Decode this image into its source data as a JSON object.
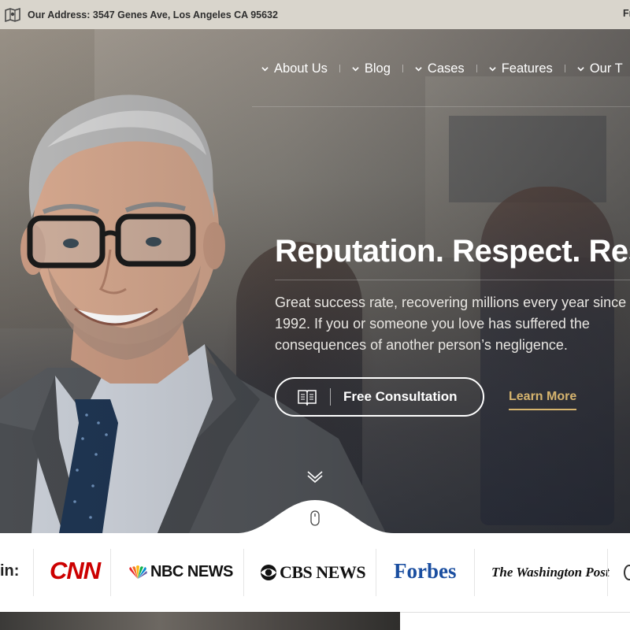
{
  "topbar": {
    "address": "Our Address: 3547 Genes Ave, Los Angeles CA 95632",
    "right_text": "Fr",
    "icon": "map-icon"
  },
  "nav": {
    "items": [
      {
        "label": "About Us"
      },
      {
        "label": "Blog"
      },
      {
        "label": "Cases"
      },
      {
        "label": "Features"
      },
      {
        "label": "Our T"
      }
    ]
  },
  "hero": {
    "headline": "Reputation. Respect. Result",
    "description": "Great success rate, recovering millions every year since 1992. If you or someone you love has suffered the consequences of another person’s negligence.",
    "consult_label": "Free Consultation",
    "learn_more_label": "Learn More",
    "accent_color": "#d6b46e"
  },
  "press": {
    "label": "in:",
    "logos": {
      "cnn": "CNN",
      "nbc": "NBC NEWS",
      "cbs": "CBS NEWS",
      "forbes": "Forbes",
      "wapo": "The Washington Post"
    }
  }
}
